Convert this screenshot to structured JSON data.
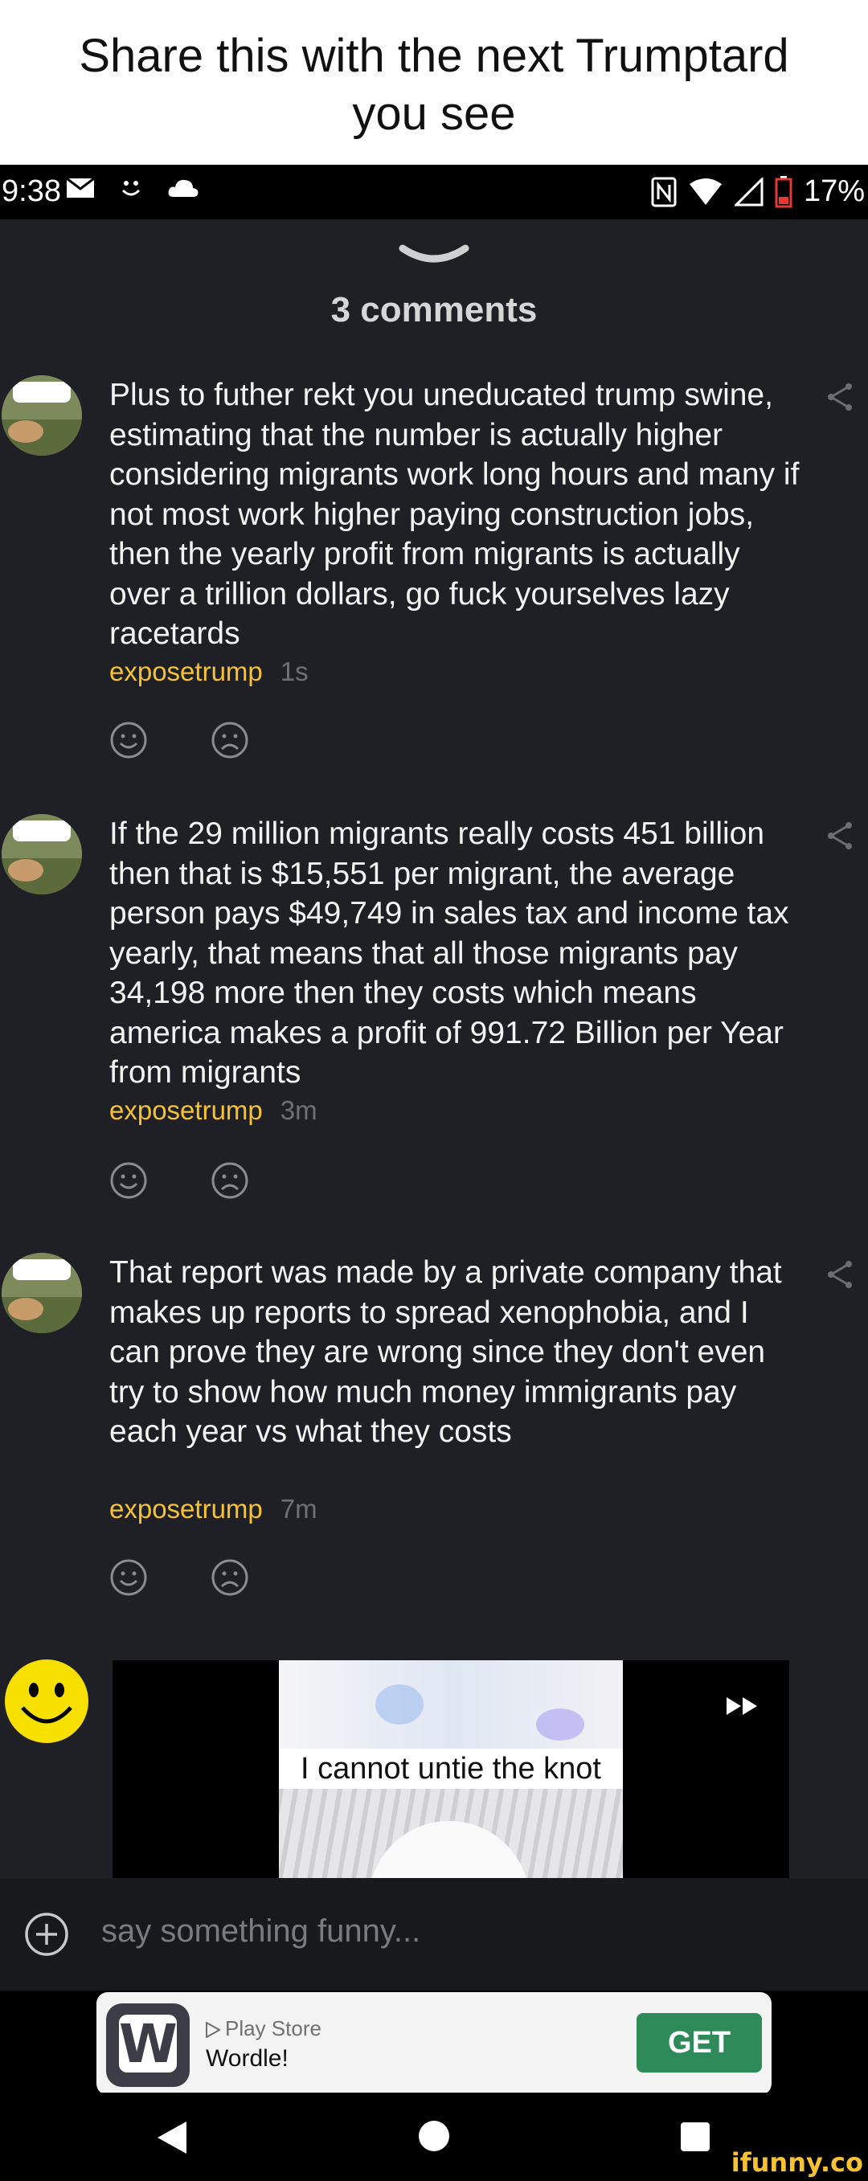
{
  "caption": {
    "line1": "Share this with the next Trumptard",
    "line2": "you see"
  },
  "status": {
    "time": "9:38",
    "battery": "17%"
  },
  "sheet": {
    "title": "3 comments"
  },
  "comments": [
    {
      "text": "Plus to futher rekt you uneducated trump swine, estimating that the number is actually higher considering migrants work long hours and many if not most work higher paying construction jobs, then the yearly profit from migrants is actually over a trillion dollars, go fuck yourselves lazy racetards",
      "author": "exposetrump",
      "age": "1s"
    },
    {
      "text": "If the 29 million migrants really costs 451 billion then that is $15,551 per migrant, the average person pays $49,749 in sales tax and income tax yearly, that means that all those migrants pay 34,198 more then they costs which means america makes a profit of 991.72 Billion per Year from migrants",
      "author": "exposetrump",
      "age": "3m"
    },
    {
      "text": "That report was made by a private company that makes up reports to spread xenophobia, and I can prove they are wrong since they don't even try to show how much money immigrants pay each year vs what they costs",
      "author": "exposetrump",
      "age": "7m"
    }
  ],
  "media": {
    "caption": "I cannot untie the knot"
  },
  "input": {
    "placeholder": "say something funny..."
  },
  "ad": {
    "store": "Play Store",
    "app": "Wordle!",
    "cta": "GET",
    "icon_letter": "W"
  },
  "watermark": "ifunny.co",
  "colors": {
    "accent": "#f6c234",
    "background": "#1f2026",
    "cta": "#2f8a5a"
  }
}
